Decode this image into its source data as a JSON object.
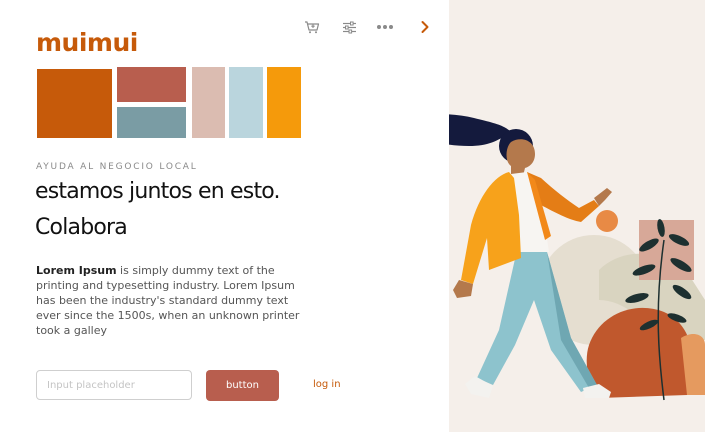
{
  "brand": {
    "logo": "muimui",
    "accent_color": "#c65a0a"
  },
  "toolbar": {
    "icons": [
      "cart-icon",
      "sliders-icon",
      "more-dots-icon",
      "chevron-right-icon"
    ]
  },
  "palette": [
    "#c65a0a",
    "#b85e4e",
    "#7a9ca4",
    "#dbbcb1",
    "#bad5dd",
    "#f59a0b"
  ],
  "hero": {
    "eyebrow": "AYUDA AL NEGOCIO LOCAL",
    "headline_line1": "estamos juntos en esto.",
    "headline_line2": "Colabora",
    "body_bold": "Lorem Ipsum",
    "body_rest": " is simply dummy text of the printing and typesetting industry. Lorem Ipsum has been the industry's standard dummy text ever since the 1500s, when an unknown printer took a galley"
  },
  "form": {
    "input_placeholder": "Input placeholder",
    "input_value": "",
    "button_label": "button",
    "login_label": "log in",
    "button_color": "#b85e4e"
  },
  "illustration": {
    "background_color": "#f5efea"
  }
}
